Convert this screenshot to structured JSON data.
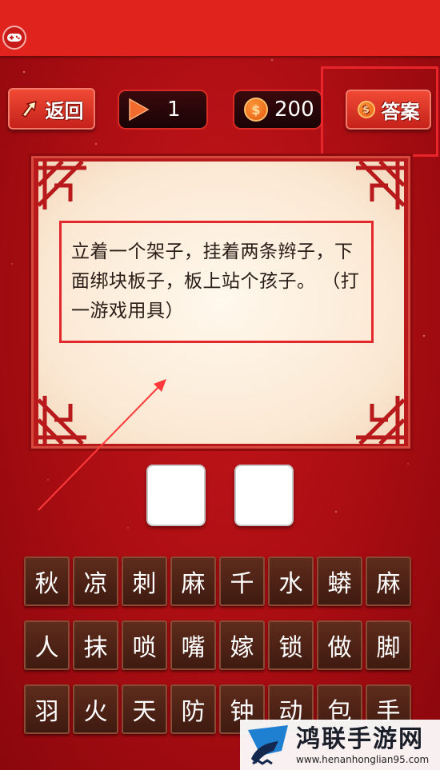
{
  "toolbar": {
    "back_label": "返回",
    "level": "1",
    "coins": "200",
    "coin_symbol": "$",
    "answer_label": "答案"
  },
  "riddle": {
    "text": "立着一个架子，挂着两条辫子，下面绑块板子，板上站个孩子。 （打一游戏用具）"
  },
  "answer_slots": [
    "",
    ""
  ],
  "chars": [
    [
      "秋",
      "凉",
      "刺",
      "麻",
      "千",
      "水",
      "蟒",
      "麻"
    ],
    [
      "人",
      "抹",
      "唢",
      "嘴",
      "嫁",
      "锁",
      "做",
      "脚"
    ],
    [
      "羽",
      "火",
      "天",
      "防",
      "钟",
      "动",
      "包",
      "手"
    ]
  ],
  "watermark": {
    "title": "鸿联手游网",
    "url": "www.henanhonglian95.com"
  },
  "colors": {
    "background": "#a80d12",
    "topbar": "#e0231d",
    "highlight": "#e2282c",
    "tile": "#4a2014",
    "coin": "#e2560c"
  },
  "icons": {
    "gamepad": "gamepad-icon",
    "back": "back-arrow-icon",
    "level": "play-triangle-icon",
    "coin": "coin-icon"
  }
}
